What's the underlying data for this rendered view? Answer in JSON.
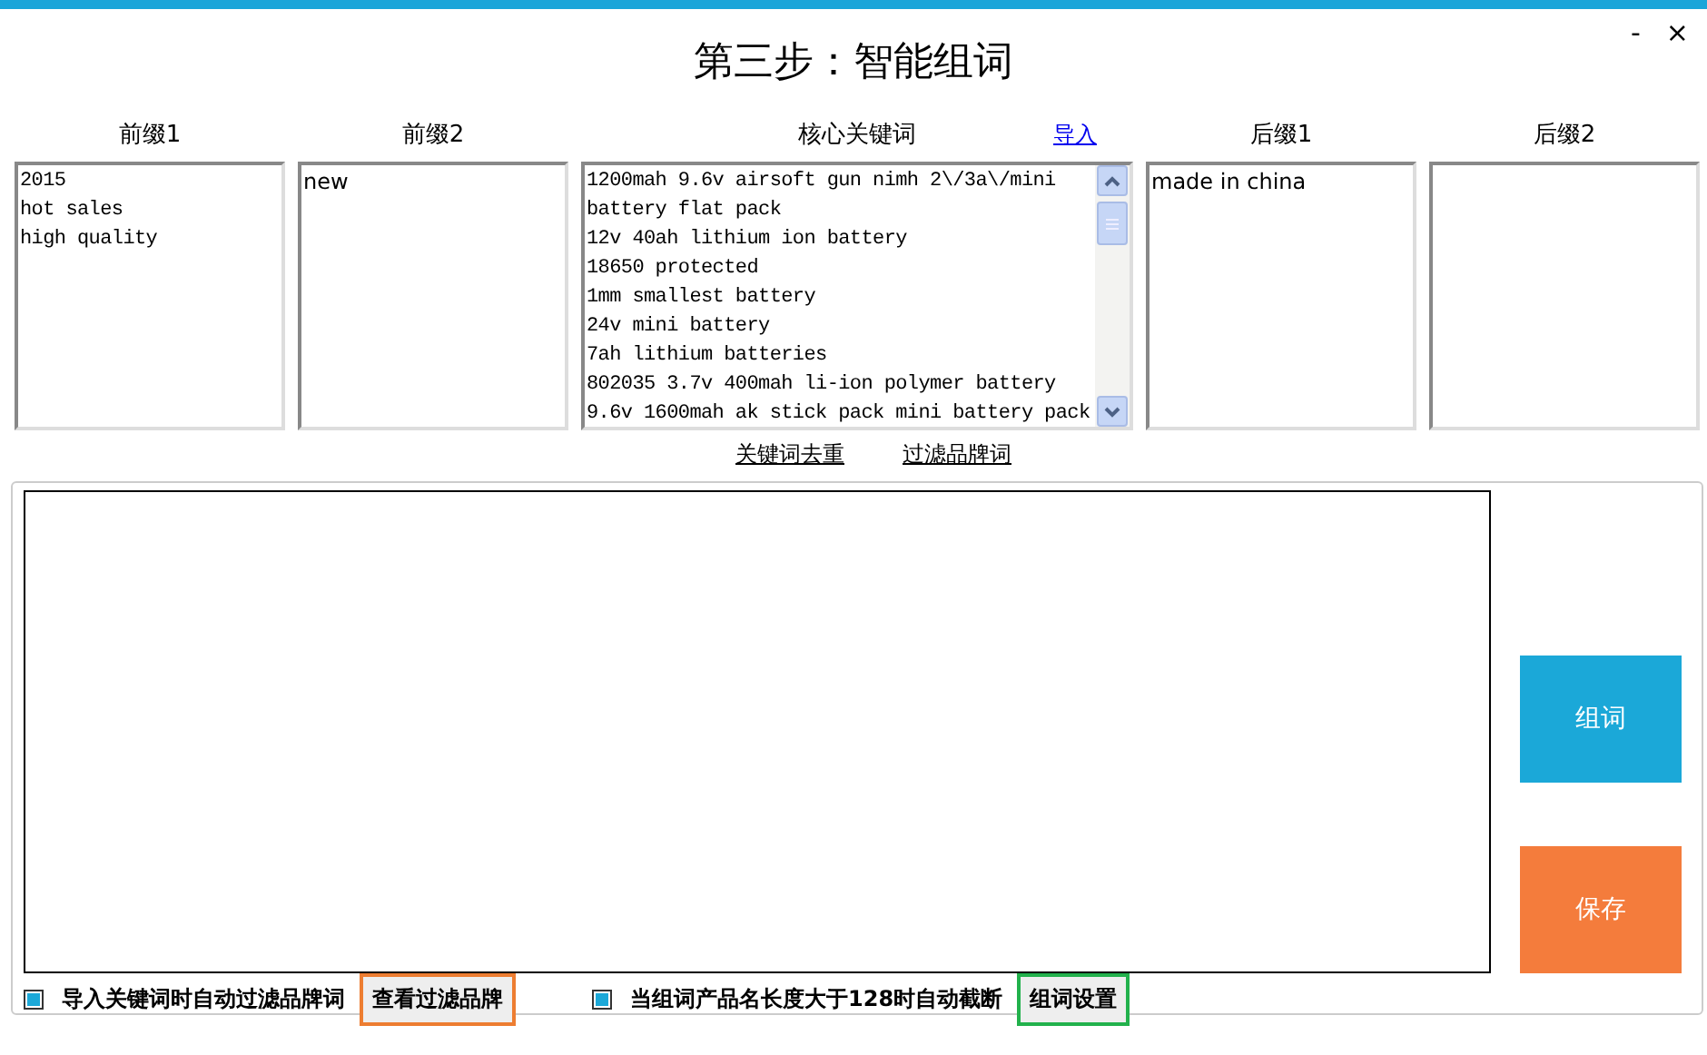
{
  "window": {
    "title": "第三步：智能组词",
    "controls": [
      "-",
      "×"
    ]
  },
  "lists": [
    {
      "label": "前缀1",
      "kind": "mono",
      "lines": [
        "2015",
        "hot sales",
        "high quality"
      ]
    },
    {
      "label": "前缀2",
      "kind": "sans",
      "lines": [
        "new"
      ]
    },
    {
      "label": "核心关键词",
      "kind": "scroll",
      "link": "导入",
      "lines": [
        "1200mah 9.6v airsoft gun nimh 2\\/3a\\/mini",
        "battery flat pack",
        "12v 40ah lithium ion battery",
        "18650 protected",
        "1mm smallest battery",
        "24v mini battery",
        "7ah lithium batteries",
        "802035 3.7v 400mah li-ion polymer battery",
        "9.6v 1600mah ak stick pack mini battery pack"
      ]
    },
    {
      "label": "后缀1",
      "kind": "sans",
      "lines": [
        "made in china"
      ]
    },
    {
      "label": "后缀2",
      "kind": "sans"
    }
  ],
  "links": [
    "关键词去重",
    "过滤品牌词"
  ],
  "actions": [
    {
      "label": "组词",
      "color": "#1ba8d8"
    },
    {
      "label": "保存",
      "color": "#f47c3c"
    }
  ],
  "options": [
    {
      "label": "导入关键词时自动过滤品牌词",
      "checked": true,
      "button": "查看过滤品牌",
      "color": "#ed7d31"
    },
    {
      "label": "当组词产品名长度大于128时自动截断",
      "checked": true,
      "button": "组词设置",
      "color": "#22b14c"
    }
  ]
}
